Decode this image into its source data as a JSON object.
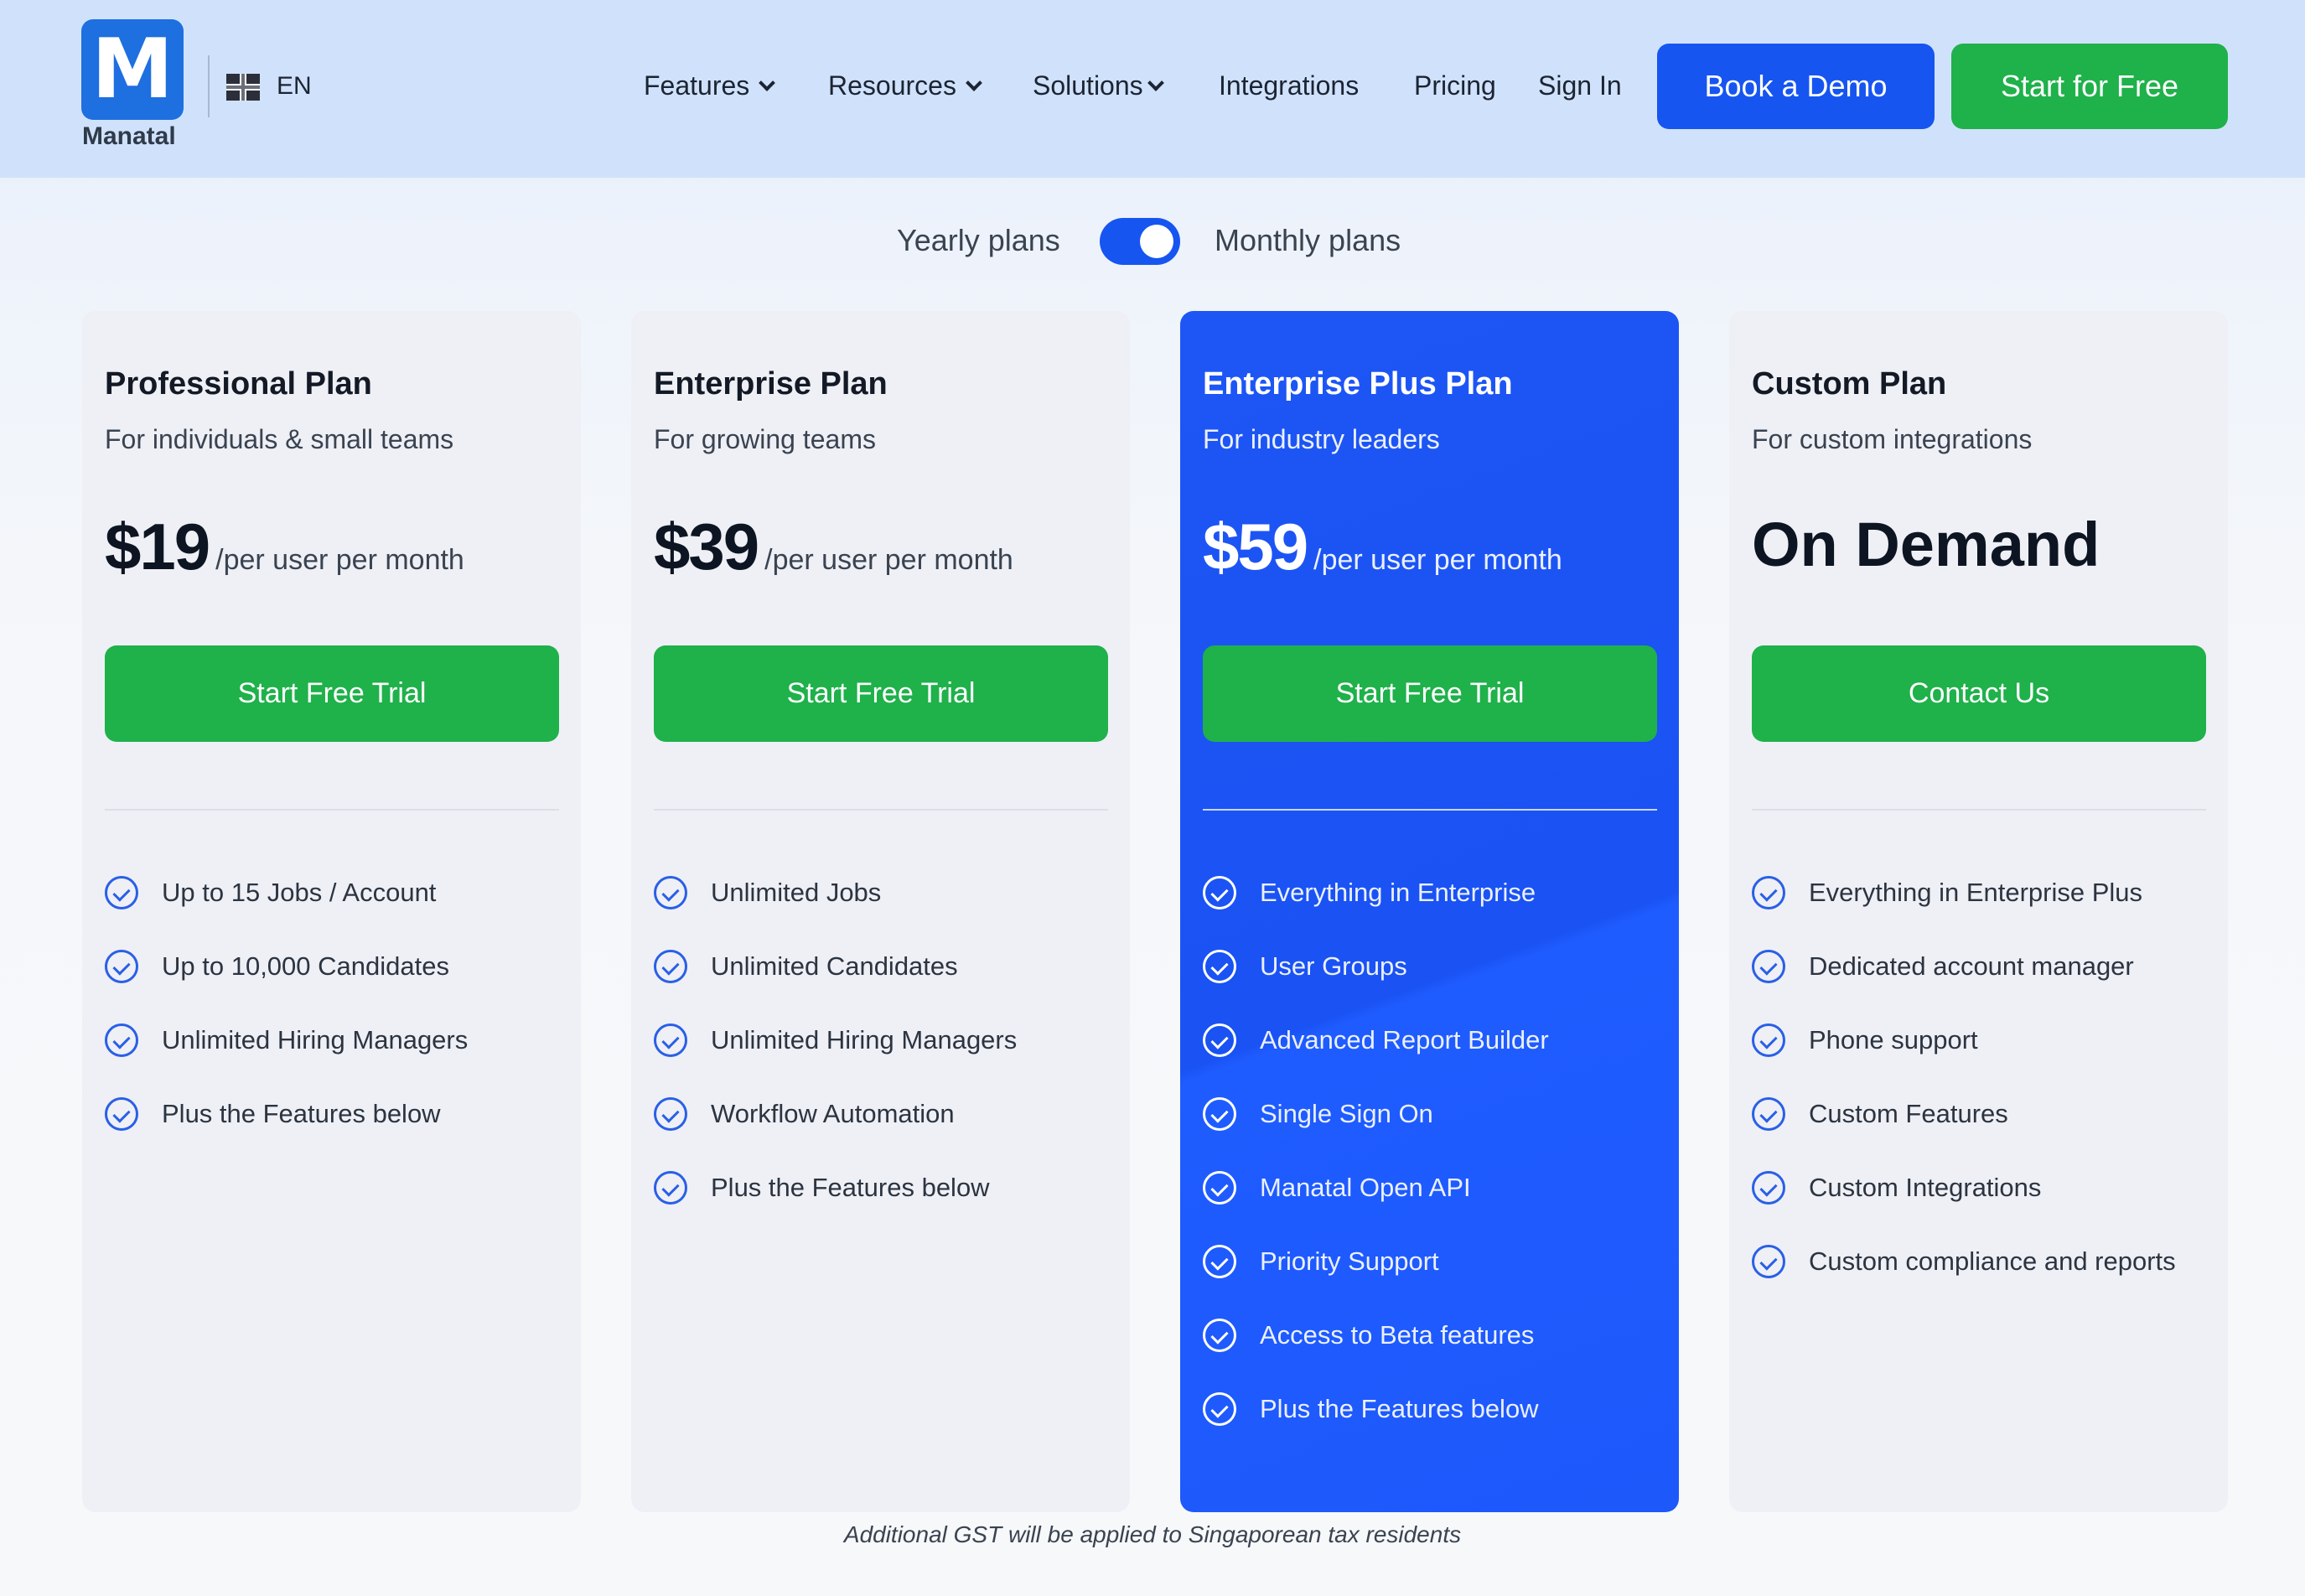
{
  "header": {
    "logo_letter": "M",
    "logo_text": "Manatal",
    "language": "EN",
    "nav": [
      {
        "label": "Features",
        "dropdown": true
      },
      {
        "label": "Resources",
        "dropdown": true
      },
      {
        "label": "Solutions",
        "dropdown": true
      },
      {
        "label": "Integrations",
        "dropdown": false
      },
      {
        "label": "Pricing",
        "dropdown": false
      },
      {
        "label": "Sign In",
        "dropdown": false
      }
    ],
    "book_demo_label": "Book a Demo",
    "start_free_label": "Start for Free"
  },
  "billing_toggle": {
    "left_label": "Yearly plans",
    "right_label": "Monthly plans",
    "selected": "Monthly plans"
  },
  "plans": [
    {
      "title": "Professional Plan",
      "subtitle": "For individuals & small teams",
      "price": "$19",
      "per": "/per user per month",
      "cta": "Start Free Trial",
      "features": [
        "Up to 15 Jobs / Account",
        "Up to 10,000 Candidates",
        "Unlimited Hiring Managers",
        "Plus the Features below"
      ]
    },
    {
      "title": "Enterprise Plan",
      "subtitle": "For growing teams",
      "price": "$39",
      "per": "/per user per month",
      "cta": "Start Free Trial",
      "features": [
        "Unlimited Jobs",
        "Unlimited Candidates",
        "Unlimited Hiring Managers",
        "Workflow Automation",
        "Plus the Features below"
      ]
    },
    {
      "title": "Enterprise Plus Plan",
      "subtitle": "For industry leaders",
      "price": "$59",
      "per": "/per user per month",
      "cta": "Start Free Trial",
      "features": [
        "Everything in Enterprise",
        "User Groups",
        "Advanced Report Builder",
        "Single Sign On",
        "Manatal Open API",
        "Priority Support",
        "Access to Beta features",
        "Plus the Features below"
      ]
    },
    {
      "title": "Custom Plan",
      "subtitle": "For custom integrations",
      "price": "On Demand",
      "per": "",
      "cta": "Contact Us",
      "features": [
        "Everything in Enterprise Plus",
        "Dedicated account manager",
        "Phone support",
        "Custom Features",
        "Custom Integrations",
        "Custom compliance and reports"
      ]
    }
  ],
  "footnote": "Additional GST will be applied to Singaporean tax residents",
  "colors": {
    "primary_blue": "#1655f0",
    "green": "#1fb14a",
    "header_bg": "#d0e2fb"
  }
}
